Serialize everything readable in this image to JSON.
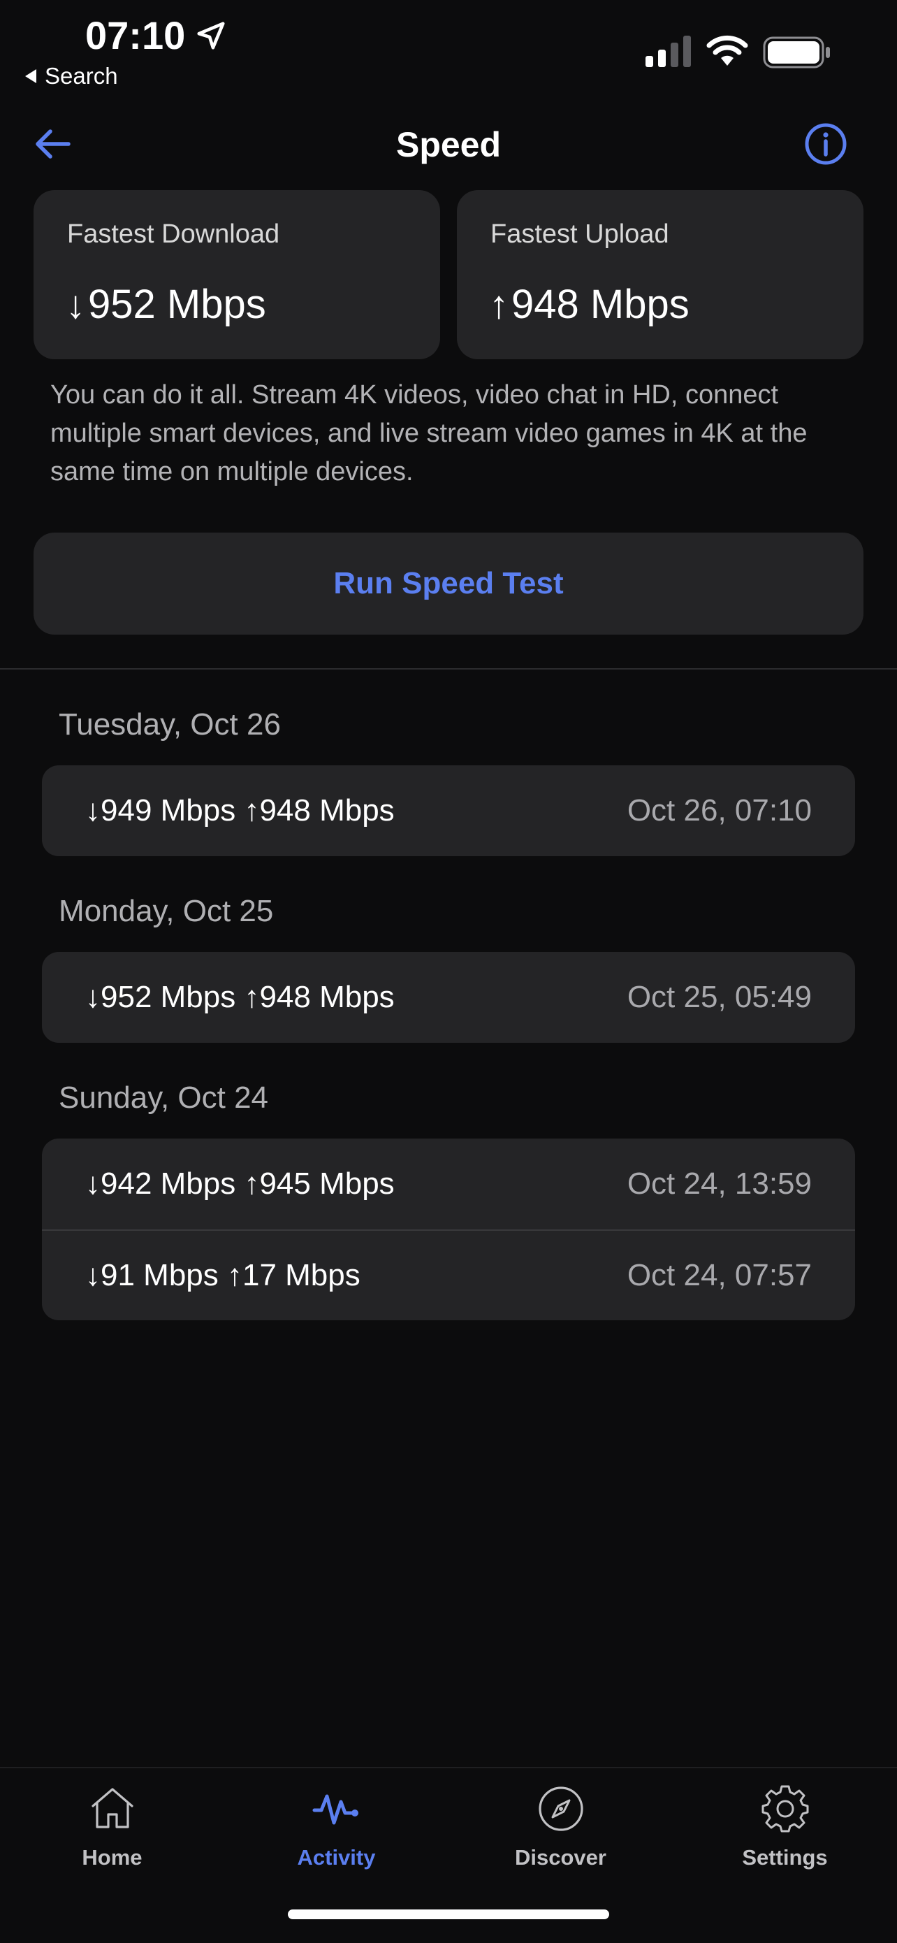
{
  "status_bar": {
    "time": "07:10",
    "back_label": "Search"
  },
  "nav": {
    "title": "Speed"
  },
  "fastest": {
    "download": {
      "label": "Fastest Download",
      "arrow": "↓",
      "value": "952 Mbps"
    },
    "upload": {
      "label": "Fastest Upload",
      "arrow": "↑",
      "value": "948 Mbps"
    }
  },
  "description": "You can do it all. Stream 4K videos, video chat in HD, connect multiple smart devices, and live stream video games in 4K at the same time on multiple devices.",
  "run_button": {
    "label": "Run Speed Test"
  },
  "history": [
    {
      "day": "Tuesday, Oct 26",
      "results": [
        {
          "speeds": "↓949 Mbps ↑948 Mbps",
          "time": "Oct 26, 07:10"
        }
      ]
    },
    {
      "day": "Monday, Oct 25",
      "results": [
        {
          "speeds": "↓952 Mbps ↑948 Mbps",
          "time": "Oct 25, 05:49"
        }
      ]
    },
    {
      "day": "Sunday, Oct 24",
      "results": [
        {
          "speeds": "↓942 Mbps ↑945 Mbps",
          "time": "Oct 24, 13:59"
        },
        {
          "speeds": "↓91 Mbps ↑17 Mbps",
          "time": "Oct 24, 07:57"
        }
      ]
    }
  ],
  "tabs": [
    {
      "label": "Home",
      "icon": "home-icon",
      "active": false
    },
    {
      "label": "Activity",
      "icon": "activity-icon",
      "active": true
    },
    {
      "label": "Discover",
      "icon": "compass-icon",
      "active": false
    },
    {
      "label": "Settings",
      "icon": "gear-icon",
      "active": false
    }
  ],
  "colors": {
    "accent": "#5b7ff0",
    "background": "#0c0c0d",
    "card": "#242426",
    "secondary_text": "#b0b0b3"
  }
}
